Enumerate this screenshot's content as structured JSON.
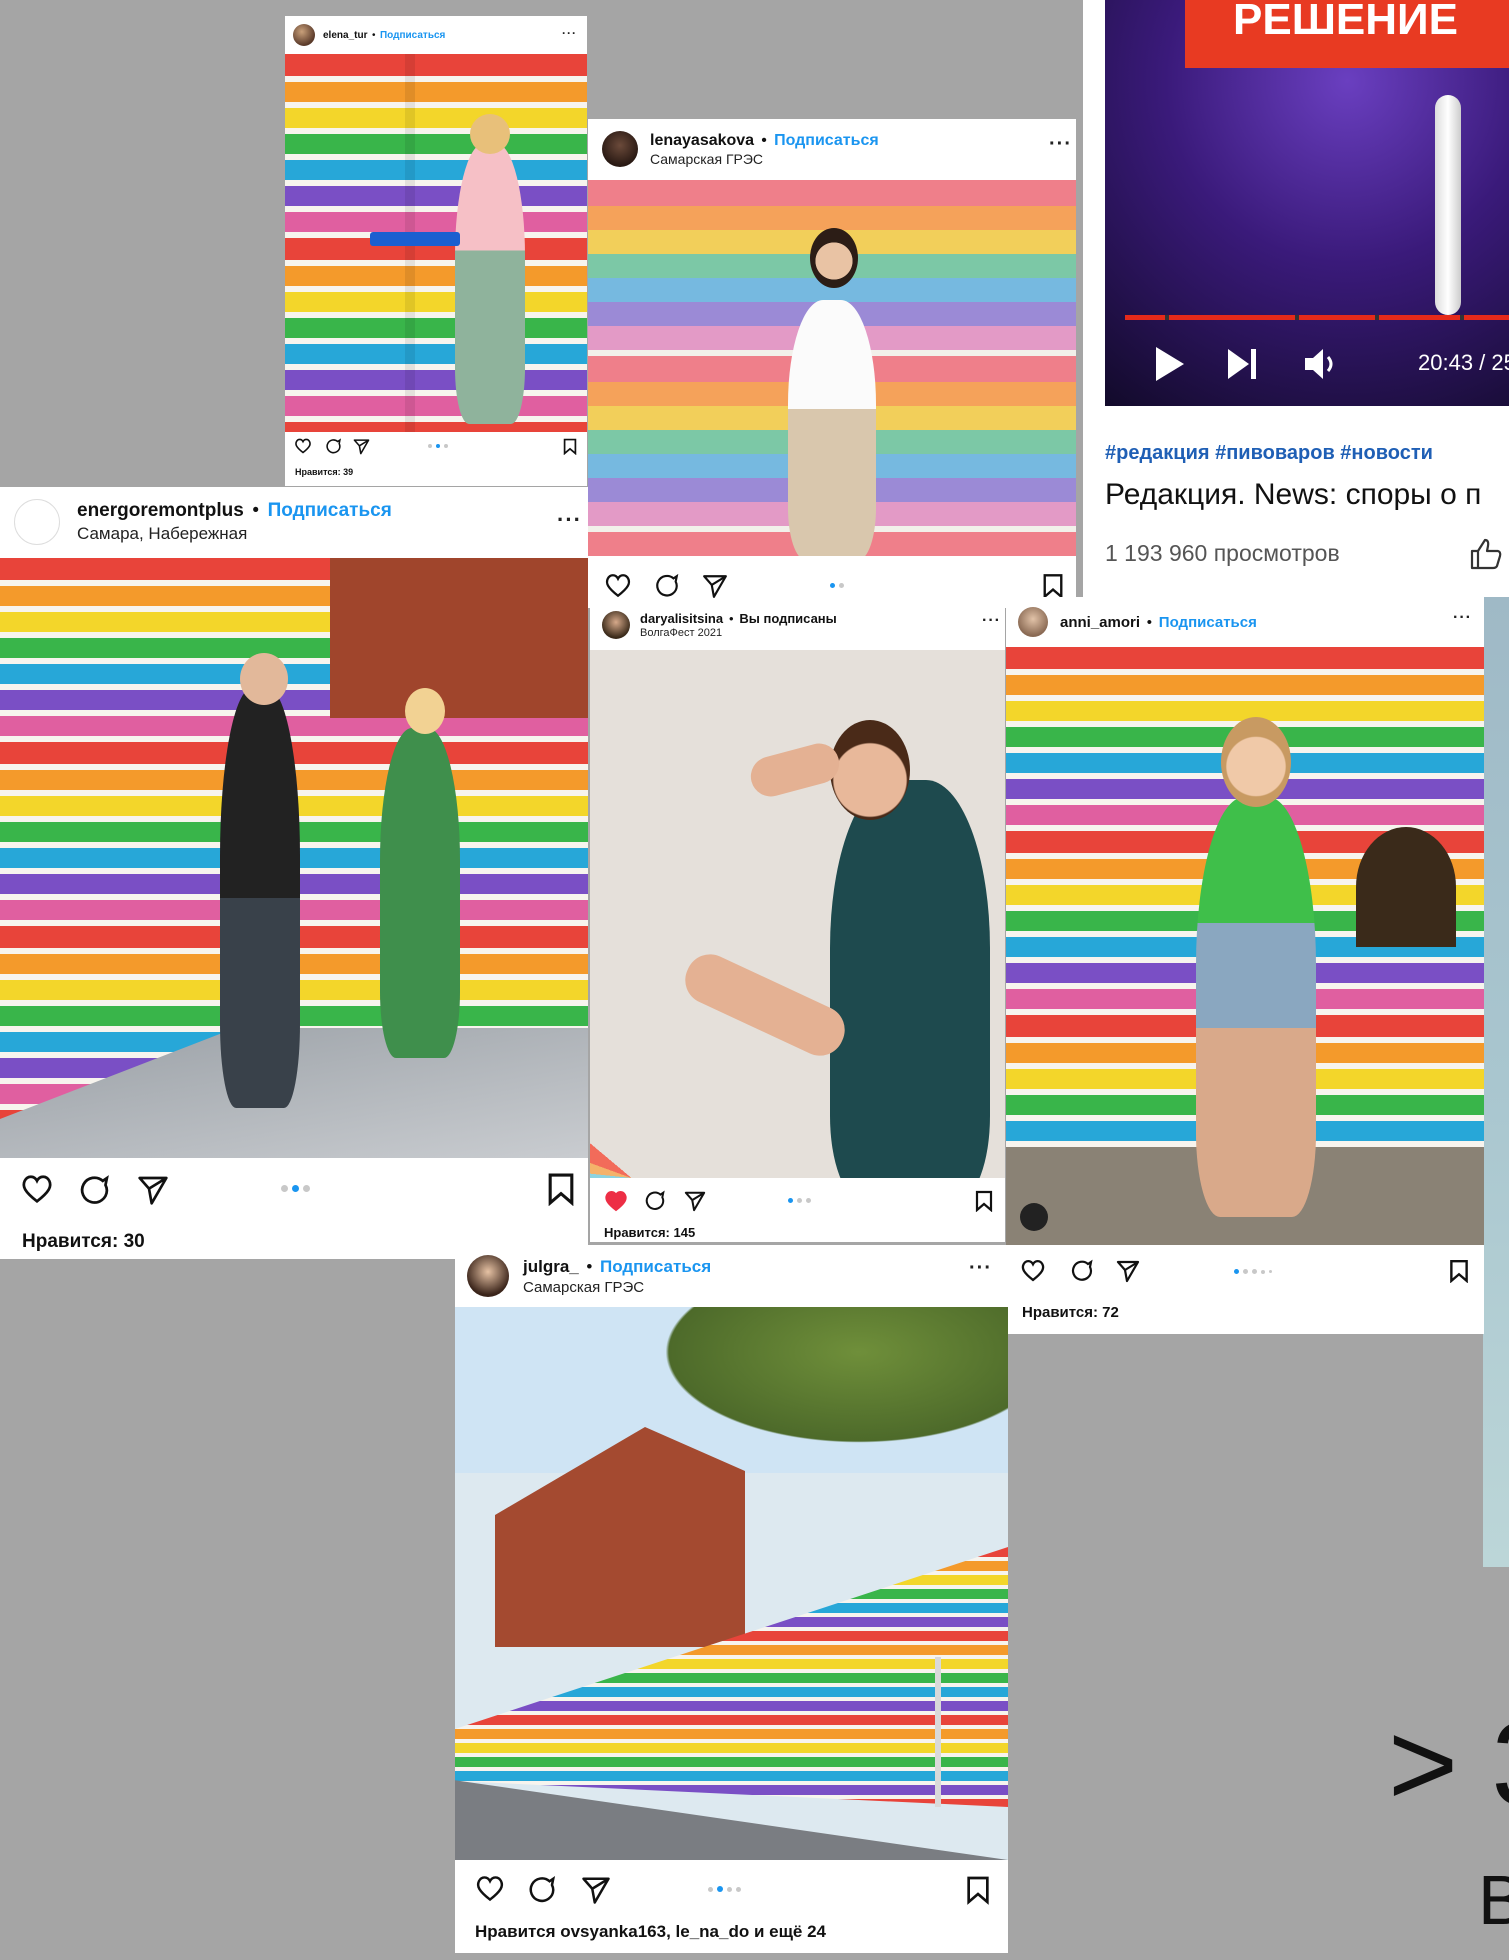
{
  "video": {
    "banner": "РЕШЕНИЕ",
    "time": "20:43 / 25:",
    "tags": "#редакция #пивоваров #новости",
    "title": "Редакция. News: споры о п",
    "views": "1 193 960 просмотров"
  },
  "posts": [
    {
      "user": "elena_tur",
      "follow": "Подписаться",
      "likes": "Нравится: 39"
    },
    {
      "user": "lenayasakova",
      "follow": "Подписаться",
      "location": "Самарская ГРЭС"
    },
    {
      "user": "energoremontplus",
      "follow": "Подписаться",
      "location": "Самара, Набережная",
      "likes": "Нравится: 30"
    },
    {
      "user": "daryalisitsina",
      "follow": "Вы подписаны",
      "location": "ВолгаФест 2021",
      "likes": "Нравится: 145"
    },
    {
      "user": "anni_amori",
      "follow": "Подписаться",
      "likes": "Нравится: 72"
    },
    {
      "user": "julgra_",
      "follow": "Подписаться",
      "location": "Самарская ГРЭС",
      "likes": "Нравится ovsyanka163, le_na_do и ещё 24"
    }
  ],
  "overlay_text": {
    "big": "> 3",
    "small": "В"
  },
  "colors": {
    "follow": "#1a95f0",
    "background": "#a5a5a5",
    "like_red": "#ed2e45"
  }
}
